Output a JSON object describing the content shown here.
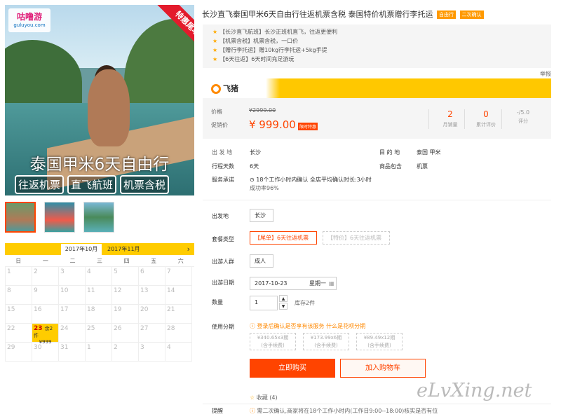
{
  "hero": {
    "logo_cn": "咕噜游",
    "logo_en": "guluyou.com",
    "ribbon": "特惠尾单",
    "big_title": "泰国甲米6天自由行",
    "tags": [
      "往返机票",
      "直飞航班",
      "机票含税"
    ]
  },
  "calendar": {
    "month_current": "2017年10月",
    "month_next": "2017年11月",
    "next_icon": "›",
    "weekdays": [
      "日",
      "一",
      "二",
      "三",
      "四",
      "五",
      "六"
    ],
    "days": [
      [
        "1",
        "2",
        "3",
        "4",
        "5",
        "6",
        "7"
      ],
      [
        "8",
        "9",
        "10",
        "11",
        "12",
        "13",
        "14"
      ],
      [
        "15",
        "16",
        "17",
        "18",
        "19",
        "20",
        "21"
      ],
      [
        "22",
        "23",
        "24",
        "25",
        "26",
        "27",
        "28"
      ],
      [
        "29",
        "30",
        "31",
        "1",
        "2",
        "3",
        "4"
      ]
    ],
    "active_day": "23",
    "active_stock": "余2件",
    "active_price": "¥999"
  },
  "product": {
    "title": "长沙直飞泰国甲米6天自由行往返机票含税 泰国特价机票赠行李托运",
    "badges": [
      "自由行",
      "二次确认"
    ]
  },
  "features": [
    "【长沙直飞航班】长沙正班机直飞，往返更便利",
    "【机票含税】机票含税，一口价",
    "【赠行李托运】赠10kg行李托运+5kg手提",
    "【6天往返】6天时间充足游玩"
  ],
  "report": "举报",
  "fliggy": {
    "name": "飞猪"
  },
  "price": {
    "label_price": "价格",
    "orig": "¥2999.00",
    "label_promo": "促销价",
    "current": "¥ 999.00",
    "limit": "限时特惠",
    "stats": [
      {
        "n": "2",
        "l": "月销量"
      },
      {
        "n": "0",
        "l": "累计评价"
      },
      {
        "n": "-/5.0",
        "l": "评分"
      }
    ]
  },
  "info": {
    "from_k": "出 发 地",
    "from_v": "长沙",
    "dest_k": "目 的 地",
    "dest_v": "泰国  甲米",
    "days_k": "行程天数",
    "days_v": "6天",
    "incl_k": "商品包含",
    "incl_v": "机票",
    "promise_k": "服务承诺",
    "promise_v1": "18个工作小时内确认 全店平均确认时长:3小时",
    "promise_v2": "成功率96%"
  },
  "options": {
    "dep_k": "出发地",
    "dep_v": "长沙",
    "pkg_k": "套餐类型",
    "pkg1": "【尾单】6天往返机票",
    "pkg2": "【特价】6天往返机票",
    "crowd_k": "出游人群",
    "crowd_v": "成人",
    "date_k": "出游日期",
    "date_v": "2017-10-23",
    "date_wd": "星期一",
    "qty_k": "数量",
    "qty_v": "1",
    "stock": "库存2件",
    "inst_k": "使用分期",
    "inst_note": "登录后确认是否享有该服务",
    "inst_link": "什么是花呗分期",
    "inst": [
      {
        "a": "¥340.65x3期",
        "b": "(含手续费)"
      },
      {
        "a": "¥173.99x6期",
        "b": "(含手续费)"
      },
      {
        "a": "¥89.49x12期",
        "b": "(含手续费)"
      }
    ]
  },
  "buttons": {
    "buy": "立即购买",
    "cart": "加入购物车"
  },
  "fav": "收藏 (4)",
  "remind_k": "提醒",
  "remind_v": "需二次确认,商家将在18个工作小时内(工作日9:00--18:00)核实是否有位",
  "watermark": "eLvXing.net"
}
